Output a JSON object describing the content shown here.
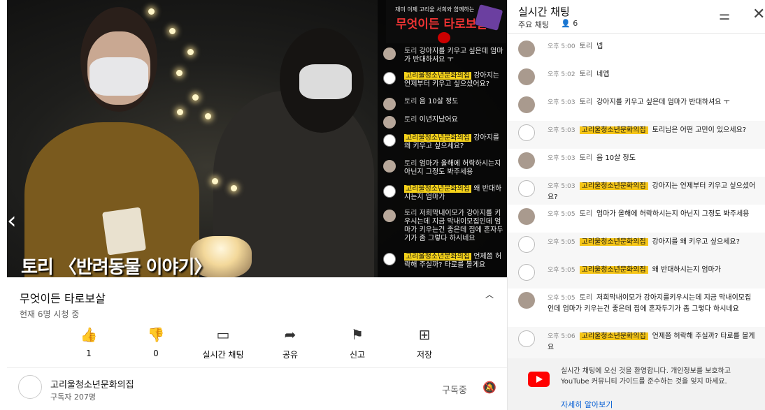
{
  "video": {
    "title_overlay": "토리 〈반려동물 이야기〉",
    "banner_small": "재미 이제 고리울 서희와 함께하는",
    "banner_big": "무엇이든 타로보살"
  },
  "overlay_messages": [
    {
      "name": "토리",
      "text": "강아지를 키우고 싶은데 엄마가 반대하셔요 ㅜ",
      "badge": false
    },
    {
      "name": "고리울청소년문화의집",
      "text": "강아지는 언제부터 키우고 싶으셨어요?",
      "badge": true
    },
    {
      "name": "토리",
      "text": "음 10살 정도",
      "badge": false
    },
    {
      "name": "토리",
      "text": "이년지났어요",
      "badge": false
    },
    {
      "name": "고리울청소년문화의집",
      "text": "강아지를 왜 키우고 싶으세요?",
      "badge": true
    },
    {
      "name": "토리",
      "text": "엄마가 올해에 허락하시는지 아닌지 그정도 봐주세용",
      "badge": false
    },
    {
      "name": "고리울청소년문화의집",
      "text": "왜 반대하시는지 엄마가",
      "badge": true
    },
    {
      "name": "토리",
      "text": "저희막내이모가 강아지를 키우시는데 지금 막내이모집인데 엄마가 키우는건 좋은데 집에 혼자두기가 좀 그렇다 하시네요",
      "badge": false
    },
    {
      "name": "고리울청소년문화의집",
      "text": "언제쯤 허락해 주실까? 타로를 볼게요",
      "badge": true
    }
  ],
  "info": {
    "stream_title": "무엇이든 타로보살",
    "viewers": "현재 6명 시청 중",
    "collapse_icon": "chevron-up-icon"
  },
  "actions": [
    {
      "label": "1",
      "icon": "thumbs-up-icon"
    },
    {
      "label": "0",
      "icon": "thumbs-down-icon"
    },
    {
      "label": "실시간 채팅",
      "icon": "chat-icon"
    },
    {
      "label": "공유",
      "icon": "share-icon"
    },
    {
      "label": "신고",
      "icon": "flag-icon"
    },
    {
      "label": "저장",
      "icon": "playlist-add-icon"
    }
  ],
  "channel": {
    "name": "고리울청소년문화의집",
    "subscribers": "구독자 207명",
    "subscribe_label": "구독중"
  },
  "chat": {
    "title": "실시간 채팅",
    "subtitle": "주요 채팅",
    "viewer_count": "6",
    "messages": [
      {
        "time": "오후 5:00",
        "name": "토리",
        "text": "넵",
        "badge": false
      },
      {
        "time": "오후 5:02",
        "name": "토리",
        "text": "네엡",
        "badge": false
      },
      {
        "time": "오후 5:03",
        "name": "토리",
        "text": "강아지를 키우고 싶은데 엄마가 반대하셔요 ㅜ",
        "badge": false
      },
      {
        "time": "오후 5:03",
        "name": "고리울청소년문화의집",
        "text": "토리님은 어떤 고민이 있으세요?",
        "badge": true
      },
      {
        "time": "오후 5:03",
        "name": "토리",
        "text": "음 10살 정도",
        "badge": false
      },
      {
        "time": "오후 5:03",
        "name": "고리울청소년문화의집",
        "text": "강아지는 언제부터 키우고 싶으셨어요?",
        "badge": true
      },
      {
        "time": "오후 5:05",
        "name": "토리",
        "text": "엄마가 올해에 허락하시는지 아닌지 그정도 봐주세용",
        "badge": false
      },
      {
        "time": "오후 5:05",
        "name": "고리울청소년문화의집",
        "text": "강아지를 왜 키우고 싶으세요?",
        "badge": true
      },
      {
        "time": "오후 5:05",
        "name": "고리울청소년문화의집",
        "text": "왜 반대하시는지 엄마가",
        "badge": true
      },
      {
        "time": "오후 5:05",
        "name": "토리",
        "text": "저희막내이모가 강아지를키우시는데 지금 막내이모집인데 엄마가 키우는건 좋은데 집에 혼자두기가 좀 그렇다 하시네요",
        "badge": false
      },
      {
        "time": "오후 5:06",
        "name": "고리울청소년문화의집",
        "text": "언제쯤 허락해 주실까? 타로를 볼게요",
        "badge": true
      }
    ],
    "notice": "실시간 채팅에 오신 것을 환영합니다. 개인정보를 보호하고 YouTube 커뮤니티 가이드를 준수하는 것을 잊지 마세요.",
    "notice_link": "자세히 알아보기"
  }
}
